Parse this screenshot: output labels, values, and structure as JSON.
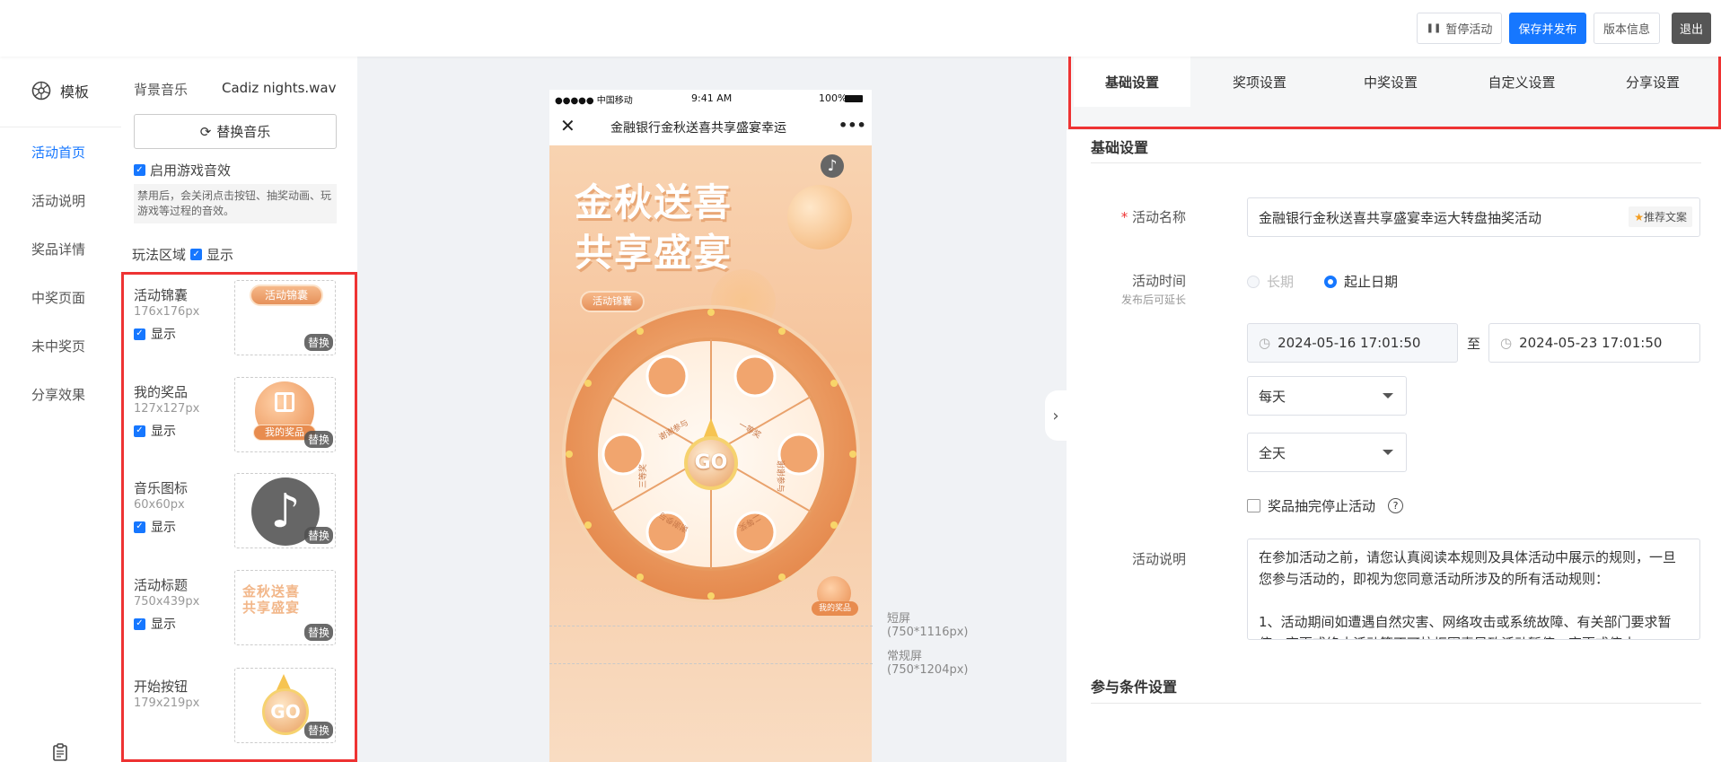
{
  "toolbar": {
    "pause_label": "暂停活动",
    "save_publish_label": "保存并发布",
    "version_label": "版本信息",
    "exit_label": "退出"
  },
  "left_nav": {
    "header": "模板",
    "items": [
      {
        "label": "活动首页",
        "active": true
      },
      {
        "label": "活动说明"
      },
      {
        "label": "奖品详情"
      },
      {
        "label": "中奖页面"
      },
      {
        "label": "未中奖页"
      },
      {
        "label": "分享效果"
      }
    ]
  },
  "config": {
    "bg_music_label": "背景音乐",
    "bg_music_file": "Cadiz nights.wav",
    "replace_music_label": "替换音乐",
    "game_sound_label": "启用游戏音效",
    "game_sound_note": "禁用后，会关闭点击按钮、抽奖动画、玩游戏等过程的音效。",
    "play_area_label": "玩法区域",
    "play_area_show": "显示",
    "assets": [
      {
        "name": "活动锦囊",
        "size": "176x176px",
        "show": "显示",
        "replace": "替换"
      },
      {
        "name": "我的奖品",
        "size": "127x127px",
        "show": "显示",
        "replace": "替换"
      },
      {
        "name": "音乐图标",
        "size": "60x60px",
        "show": "显示",
        "replace": "替换"
      },
      {
        "name": "活动标题",
        "size": "750x439px",
        "show": "显示",
        "replace": "替换"
      },
      {
        "name": "开始按钮",
        "size": "179x219px",
        "replace": "替换"
      }
    ],
    "thumb_texts": {
      "tips": "活动锦囊",
      "prize": "我的奖品",
      "title": "金秋送喜 共享盛宴",
      "go": "GO"
    }
  },
  "phone": {
    "carrier": "●●●●● 中国移动",
    "time": "9:41 AM",
    "battery": "100%",
    "title": "金融银行金秋送喜共享盛宴幸运",
    "menu": "•••",
    "headline_1": "金秋送喜",
    "headline_2": "共享盛宴",
    "tips_badge": "活动锦囊",
    "go_label": "GO",
    "my_prize": "我的奖品",
    "wheel_labels": [
      "谢谢参与",
      "一等奖",
      "谢谢参与",
      "二等奖",
      "谢谢参与",
      "三等奖"
    ]
  },
  "canvas": {
    "short_screen": "短屏",
    "short_screen_size": "(750*1116px)",
    "normal_screen": "常规屏",
    "normal_screen_size": "(750*1204px)"
  },
  "right_panel": {
    "tabs": [
      "基础设置",
      "奖项设置",
      "中奖设置",
      "自定义设置",
      "分享设置"
    ],
    "active_tab": 0,
    "section_basic": "基础设置",
    "name_label": "活动名称",
    "name_value": "金融银行金秋送喜共享盛宴幸运大转盘抽奖活动",
    "recommend_label": "推荐文案",
    "time_label": "活动时间",
    "time_hint": "发布后可延长",
    "radio_long": "长期",
    "radio_range": "起止日期",
    "start_date": "2024-05-16 17:01:50",
    "to": "至",
    "end_date": "2024-05-23 17:01:50",
    "frequency": "每天",
    "day_range": "全天",
    "stop_label": "奖品抽完停止活动",
    "desc_label": "活动说明",
    "desc_text": "在参加活动之前，请您认真阅读本规则及具体活动中展示的规则，一旦您参与活动的，即视为您同意活动所涉及的所有活动规则：\n\n1、活动期间如遭遇自然灾害、网络攻击或系统故障、有关部门要求暂停、变更或终止活动等不可抗拒因素导致活动暂停、变更或停止",
    "section_conditions": "参与条件设置"
  },
  "colors": {
    "accent": "#1677ff",
    "highlight": "#e33333",
    "wheel": "#f0a46c"
  }
}
